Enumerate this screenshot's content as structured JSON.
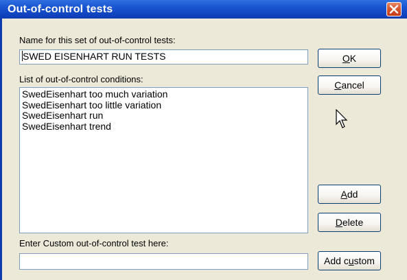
{
  "window": {
    "title": "Out-of-control tests"
  },
  "name_section": {
    "label": "Name for this set of out-of-control tests:",
    "value": "SWED EISENHART RUN TESTS"
  },
  "conditions_section": {
    "label": "List of out-of-control conditions:",
    "items": [
      "SwedEisenhart too much variation",
      "SwedEisenhart too little variation",
      "SwedEisenhart run",
      "SwedEisenhart trend"
    ]
  },
  "custom_section": {
    "label": "Enter Custom out-of-control test here:",
    "value": ""
  },
  "buttons": {
    "ok": {
      "pre": "",
      "mnemonic": "O",
      "post": "K"
    },
    "cancel": {
      "pre": "",
      "mnemonic": "C",
      "post": "ancel"
    },
    "add": {
      "pre": "",
      "mnemonic": "A",
      "post": "dd"
    },
    "delete": {
      "pre": "",
      "mnemonic": "D",
      "post": "elete"
    },
    "add_custom": {
      "pre": "Add c",
      "mnemonic": "u",
      "post": "stom"
    }
  },
  "colors": {
    "titlebar": "#1b57d3",
    "dialog_bg": "#ece9d8",
    "close_button": "#d5552f",
    "field_border": "#7f9db9"
  },
  "icons": {
    "close": "close-x-icon",
    "cursor": "mouse-pointer-icon"
  }
}
